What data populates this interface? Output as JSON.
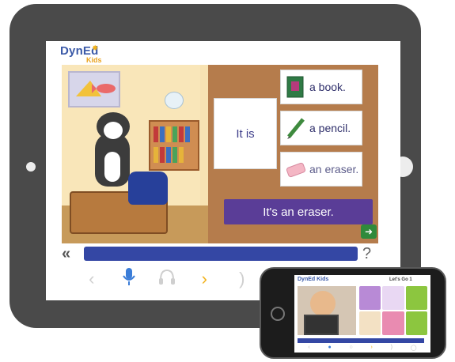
{
  "app": {
    "logo_main": "DynEd",
    "logo_sub": "Kids"
  },
  "lesson": {
    "prompt_card": "It is",
    "choices": [
      {
        "label": "a book.",
        "icon": "book-icon"
      },
      {
        "label": "a pencil.",
        "icon": "pencil-icon"
      },
      {
        "label": "an eraser.",
        "icon": "eraser-icon"
      }
    ],
    "answer": "It's an eraser."
  },
  "controls": {
    "rewind_icon": "rewind-icon",
    "help": "?",
    "toolbar": [
      {
        "name": "back-icon",
        "glyph": "‹"
      },
      {
        "name": "microphone-icon",
        "glyph": "🎙"
      },
      {
        "name": "headphones-icon",
        "glyph": "🎧"
      },
      {
        "name": "forward-icon",
        "glyph": "›"
      },
      {
        "name": "listen-icon",
        "glyph": ")"
      },
      {
        "name": "replay-icon",
        "glyph": "▷"
      },
      {
        "name": "globe-icon",
        "glyph": "◯"
      },
      {
        "name": "more-icon",
        "glyph": "○"
      }
    ]
  },
  "phone": {
    "logo": "DynEd Kids",
    "title": "Let's Go 1"
  },
  "colors": {
    "accent": "#3447a4",
    "answer_bg": "#5a3d97",
    "next": "#2f8a3b",
    "forward": "#f2b21b"
  }
}
